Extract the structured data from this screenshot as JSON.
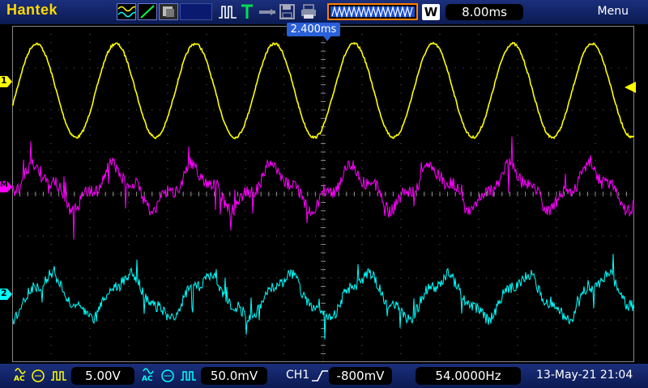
{
  "header": {
    "brand": "Hantek",
    "timebase": "8.00ms",
    "trigger_mode_label": "W",
    "menu_label": "Menu",
    "trigger_position": "2.400ms"
  },
  "channels": {
    "ch1": {
      "marker": "1",
      "color": "#ffff00"
    },
    "math": {
      "marker": "M",
      "color": "#ff00ff"
    },
    "ch2": {
      "marker": "2",
      "color": "#00ffff"
    }
  },
  "footer": {
    "ch1_coupling": "AC",
    "ch1_scale": "5.00V",
    "ch2_coupling": "AC",
    "ch2_scale": "50.0mV",
    "trigger_source": "CH1",
    "trigger_level": "-800mV",
    "frequency": "54.0000Hz",
    "datetime": "13-May-21 21:04"
  },
  "icons": [
    "waveform-icon",
    "line-icon",
    "persistence-icon",
    "pulse-icon",
    "trigger-t-icon",
    "probe-icon",
    "save-icon",
    "printer-icon"
  ]
}
